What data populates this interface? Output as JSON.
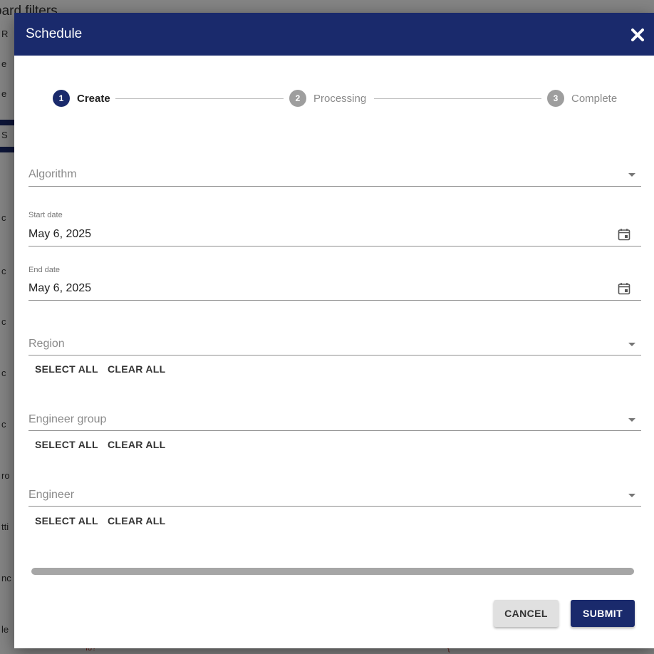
{
  "background": {
    "title": "oard filters",
    "fragments": [
      "R",
      "e",
      "e",
      "S",
      "c",
      "c",
      "c",
      "c",
      "c",
      "ro",
      "tti",
      "nc",
      "le"
    ],
    "red_text": [
      "fo?",
      "{"
    ]
  },
  "dialog": {
    "title": "Schedule",
    "close_icon": "close-icon"
  },
  "stepper": {
    "steps": [
      {
        "number": "1",
        "label": "Create",
        "state": "active"
      },
      {
        "number": "2",
        "label": "Processing",
        "state": "inactive"
      },
      {
        "number": "3",
        "label": "Complete",
        "state": "inactive"
      }
    ]
  },
  "form": {
    "algorithm": {
      "placeholder": "Algorithm"
    },
    "start_date": {
      "label": "Start date",
      "value": "May 6, 2025",
      "icon": "calendar-icon"
    },
    "end_date": {
      "label": "End date",
      "value": "May 6, 2025",
      "icon": "calendar-icon"
    },
    "region": {
      "placeholder": "Region",
      "select_all": "SELECT ALL",
      "clear_all": "CLEAR ALL"
    },
    "engineer_group": {
      "placeholder": "Engineer group",
      "select_all": "SELECT ALL",
      "clear_all": "CLEAR ALL"
    },
    "engineer": {
      "placeholder": "Engineer",
      "select_all": "SELECT ALL",
      "clear_all": "CLEAR ALL"
    }
  },
  "footer": {
    "cancel_label": "CANCEL",
    "submit_label": "SUBMIT"
  },
  "colors": {
    "primary": "#1a2a6c",
    "inactive_step": "#9e9e9e",
    "cancel_bg": "#e0e0e0"
  }
}
